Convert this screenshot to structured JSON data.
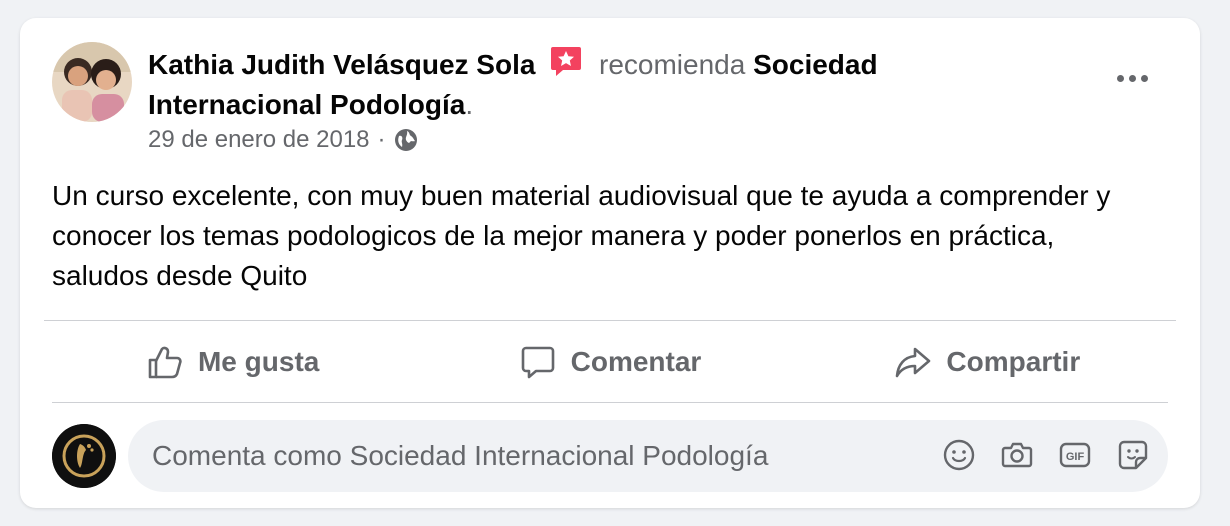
{
  "post": {
    "author_name": "Kathia Judith Velásquez Sola",
    "recommends_text": "recomienda",
    "page_name": "Sociedad Internacional Podología",
    "period": ".",
    "date": "29 de enero de 2018",
    "separator": "·",
    "audience_icon": "globe-icon",
    "recommend_icon": "recommend-star-icon",
    "body": "Un curso excelente, con muy buen material audiovisual que te ayuda a comprender y conocer los temas podologicos de la mejor manera y poder ponerlos en práctica, saludos desde Quito"
  },
  "actions": {
    "like_label": "Me gusta",
    "comment_label": "Comentar",
    "share_label": "Compartir"
  },
  "comment_box": {
    "placeholder": "Comenta como Sociedad Internacional Podología",
    "icons": [
      "emoji-icon",
      "camera-icon",
      "gif-icon",
      "sticker-icon"
    ]
  },
  "colors": {
    "background": "#f0f2f5",
    "card": "#ffffff",
    "text_primary": "#050505",
    "text_secondary": "#65676b",
    "recommend_red": "#f3425f",
    "divider": "#ced0d4"
  }
}
